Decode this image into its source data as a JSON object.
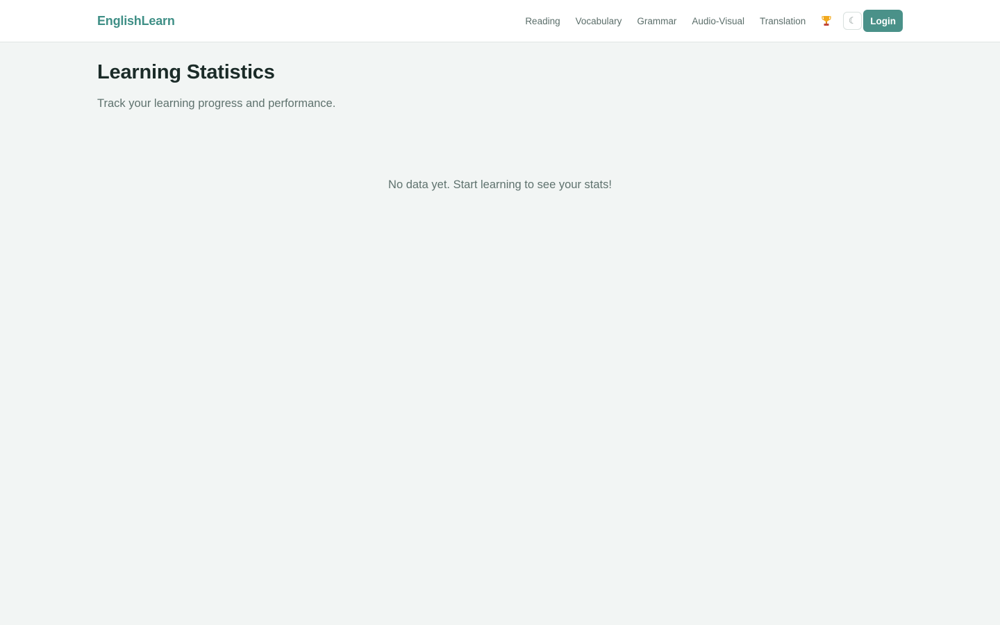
{
  "header": {
    "brand": "EnglishLearn",
    "nav": [
      {
        "label": "Reading"
      },
      {
        "label": "Vocabulary"
      },
      {
        "label": "Grammar"
      },
      {
        "label": "Audio-Visual"
      },
      {
        "label": "Translation"
      }
    ],
    "trophy_icon": "trophy-icon",
    "theme_toggle_glyph": "☾",
    "theme_toggle_icon": "moon-icon",
    "login_label": "Login"
  },
  "main": {
    "title": "Learning Statistics",
    "subtitle": "Track your learning progress and performance.",
    "empty_message": "No data yet. Start learning to see your stats!"
  },
  "colors": {
    "brand": "#3f8f86",
    "primary_button": "#4a9189",
    "background": "#f2f5f4",
    "header_background": "#ffffff"
  }
}
